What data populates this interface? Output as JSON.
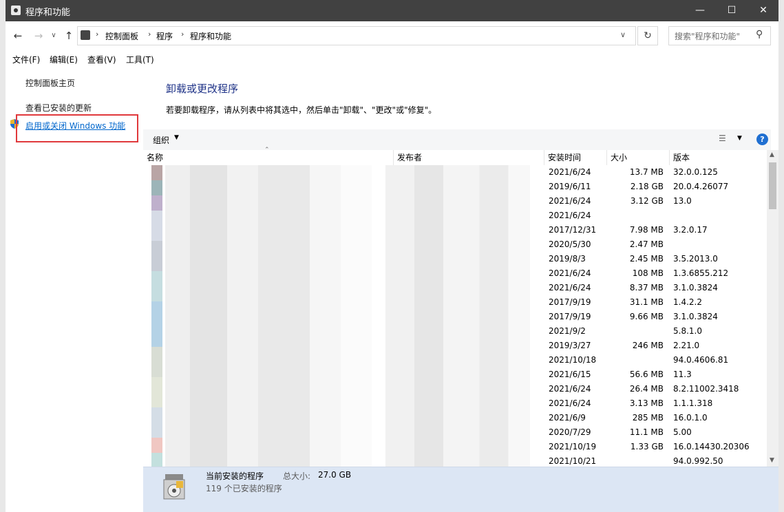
{
  "window": {
    "title": "程序和功能"
  },
  "address": {
    "crumbs": [
      "控制面板",
      "程序",
      "程序和功能"
    ],
    "search_placeholder": "搜索\"程序和功能\""
  },
  "menu": [
    "文件(F)",
    "编辑(E)",
    "查看(V)",
    "工具(T)"
  ],
  "sidebar": {
    "home": "控制面板主页",
    "updates": "查看已安装的更新",
    "features": "启用或关闭 Windows 功能"
  },
  "main": {
    "heading": "卸载或更改程序",
    "instructions": "若要卸载程序，请从列表中将其选中，然后单击\"卸载\"、\"更改\"或\"修复\"。",
    "organize": "组织"
  },
  "columns": {
    "name": "名称",
    "publisher": "发布者",
    "installed": "安装时间",
    "size": "大小",
    "version": "版本"
  },
  "rows": [
    {
      "date": "2021/6/24",
      "size": "13.7 MB",
      "version": "32.0.0.125"
    },
    {
      "date": "2019/6/11",
      "size": "2.18 GB",
      "version": "20.0.4.26077"
    },
    {
      "date": "2021/6/24",
      "size": "3.12 GB",
      "version": "13.0"
    },
    {
      "date": "2021/6/24",
      "size": "",
      "version": ""
    },
    {
      "date": "2017/12/31",
      "size": "7.98 MB",
      "version": "3.2.0.17"
    },
    {
      "date": "2020/5/30",
      "size": "2.47 MB",
      "version": ""
    },
    {
      "date": "2019/8/3",
      "size": "2.45 MB",
      "version": "3.5.2013.0"
    },
    {
      "date": "2021/6/24",
      "size": "108 MB",
      "version": "1.3.6855.212"
    },
    {
      "date": "2021/6/24",
      "size": "8.37 MB",
      "version": "3.1.0.3824"
    },
    {
      "date": "2017/9/19",
      "size": "31.1 MB",
      "version": "1.4.2.2"
    },
    {
      "date": "2017/9/19",
      "size": "9.66 MB",
      "version": "3.1.0.3824"
    },
    {
      "date": "2021/9/2",
      "size": "",
      "version": "5.8.1.0"
    },
    {
      "date": "2019/3/27",
      "size": "246 MB",
      "version": "2.21.0"
    },
    {
      "date": "2021/10/18",
      "size": "",
      "version": "94.0.4606.81"
    },
    {
      "date": "2021/6/15",
      "size": "56.6 MB",
      "version": "11.3"
    },
    {
      "date": "2021/6/24",
      "size": "26.4 MB",
      "version": "8.2.11002.3418"
    },
    {
      "date": "2021/6/24",
      "size": "3.13 MB",
      "version": "1.1.1.318"
    },
    {
      "date": "2021/6/9",
      "size": "285 MB",
      "version": "16.0.1.0"
    },
    {
      "date": "2020/7/29",
      "size": "11.1 MB",
      "version": "5.00"
    },
    {
      "date": "2021/10/19",
      "size": "1.33 GB",
      "version": "16.0.14430.20306"
    },
    {
      "date": "2021/10/21",
      "size": "",
      "version": "94.0.992.50"
    }
  ],
  "footer": {
    "title": "当前安装的程序",
    "total_label": "总大小:",
    "total": "27.0 GB",
    "count": "119 个已安装的程序"
  }
}
